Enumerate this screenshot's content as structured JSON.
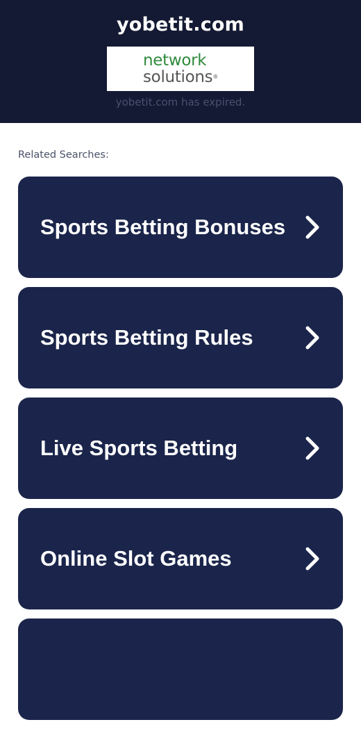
{
  "header": {
    "domain": "yobetit.com",
    "logo": {
      "line1": "network",
      "line2": "solutions",
      "registered_mark": "®"
    },
    "expired_message": "yobetit.com has expired."
  },
  "related": {
    "label": "Related Searches:",
    "items": [
      {
        "label": "Sports Betting Bonuses",
        "icon": "chevron-right-icon"
      },
      {
        "label": "Sports Betting Rules",
        "icon": "chevron-right-icon"
      },
      {
        "label": "Live Sports Betting",
        "icon": "chevron-right-icon"
      },
      {
        "label": "Online Slot Games",
        "icon": "chevron-right-icon"
      },
      {
        "label": "",
        "icon": "chevron-right-icon"
      }
    ]
  },
  "colors": {
    "header_bg": "#141a33",
    "card_bg": "#1b254b",
    "logo_green": "#2f8a3c",
    "logo_gray": "#555555"
  }
}
